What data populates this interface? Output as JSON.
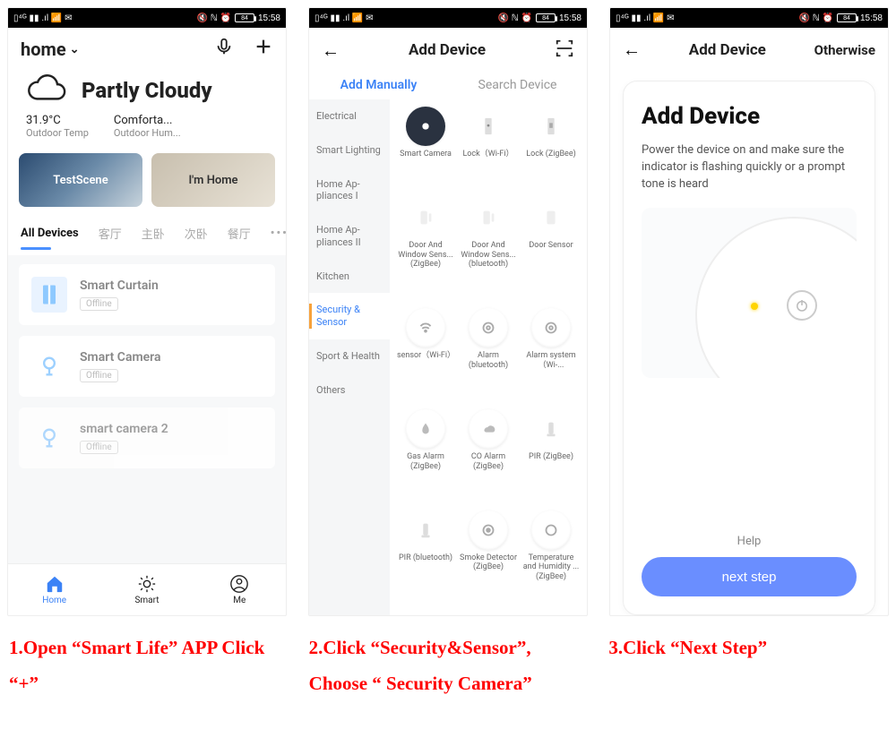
{
  "statusbar": {
    "carrier_icons": "⇅ 📶 📶 🗨",
    "right_icons": "🔕 ℕ ⏰",
    "battery": "84",
    "time": "15:58"
  },
  "screen1": {
    "home_label": "home",
    "weather_title": "Partly Cloudy",
    "temp_value": "31.9°C",
    "temp_label": "Outdoor Temp",
    "hum_value": "Comforta...",
    "hum_label": "Outdoor Hum...",
    "scene1": "TestScene",
    "scene2": "I'm Home",
    "tabs": [
      "All Devices",
      "客厅",
      "主卧",
      "次卧",
      "餐厅"
    ],
    "devices": [
      {
        "name": "Smart Curtain",
        "status": "Offline"
      },
      {
        "name": "Smart  Camera",
        "status": "Offline"
      },
      {
        "name": "smart camera 2",
        "status": "Offline"
      }
    ],
    "nav": {
      "home": "Home",
      "smart": "Smart",
      "me": "Me"
    }
  },
  "screen2": {
    "title": "Add Device",
    "mode_manual": "Add Manually",
    "mode_search": "Search Device",
    "sidebar": [
      "Electrical",
      "Smart Lighting",
      "Home Ap-pliances I",
      "Home Ap-pliances II",
      "Kitchen",
      "Security & Sensor",
      "Sport & Health",
      "Others"
    ],
    "grid": [
      {
        "n": "Smart Camera"
      },
      {
        "n": "Lock（Wi-Fi）"
      },
      {
        "n": "Lock (ZigBee)"
      },
      {
        "n": "Door And Window Sens... (ZigBee)"
      },
      {
        "n": "Door And Window Sens... (bluetooth)"
      },
      {
        "n": "Door Sensor"
      },
      {
        "n": "sensor（Wi-Fi）"
      },
      {
        "n": "Alarm (bluetooth)"
      },
      {
        "n": "Alarm system（Wi-..."
      },
      {
        "n": "Gas Alarm (ZigBee)"
      },
      {
        "n": "CO Alarm (ZigBee)"
      },
      {
        "n": "PIR (ZigBee)"
      },
      {
        "n": "PIR (bluetooth)"
      },
      {
        "n": "Smoke Detector (ZigBee)"
      },
      {
        "n": "Temperature and Humidity ... (ZigBee)"
      }
    ]
  },
  "screen3": {
    "title": "Add Device",
    "otherwise": "Otherwise",
    "big_title": "Add Device",
    "desc": "Power the device on and make sure the indicator is flashing quickly or a prompt tone is heard",
    "help": "Help",
    "next": "next step"
  },
  "captions": {
    "c1": "1.Open “Smart Life” APP Click “+”",
    "c2": "2.Click “Security&Sensor”, Choose “ Security Camera”",
    "c3": "3.Click “Next Step”"
  }
}
